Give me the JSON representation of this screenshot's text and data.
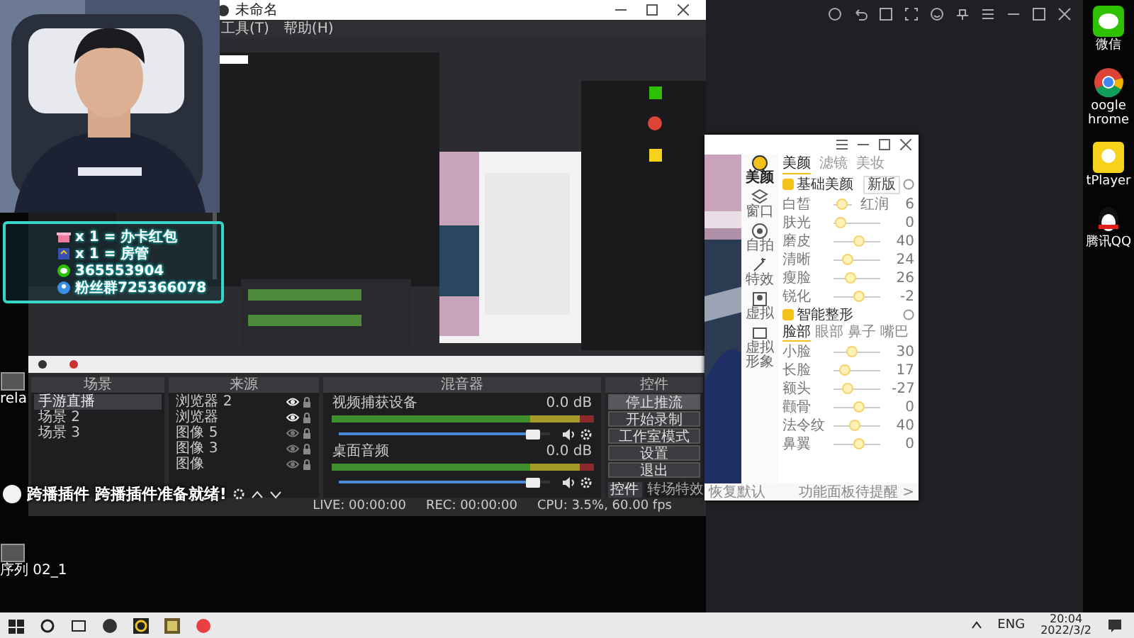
{
  "overlay": {
    "lines": [
      {
        "kind": "gift",
        "text": "x 1 = 办卡红包"
      },
      {
        "kind": "badge",
        "text": "x 1 = 房管"
      },
      {
        "kind": "wechat",
        "text": "365553904"
      },
      {
        "kind": "group",
        "text": "粉丝群725366078"
      }
    ]
  },
  "notification": {
    "text": "跨播插件 跨播插件准备就绪!"
  },
  "desktop_left": [
    {
      "label": "rela"
    },
    {
      "label": "序列 02_1"
    }
  ],
  "desktop_right": [
    {
      "kind": "chat",
      "label": "微信"
    },
    {
      "kind": "browser",
      "label": "oogle hrome"
    },
    {
      "kind": "player",
      "label": "tPlayer"
    },
    {
      "kind": "penguin",
      "label": "腾讯QQ"
    }
  ],
  "obs": {
    "title": "未命名",
    "menu": [
      "工具(T)",
      "帮助(H)"
    ],
    "scenes": {
      "title": "场景",
      "items": [
        {
          "label": "手游直播",
          "selected": true
        },
        {
          "label": "场景 2",
          "selected": false
        },
        {
          "label": "场景 3",
          "selected": false
        }
      ]
    },
    "sources": {
      "title": "来源",
      "items": [
        {
          "label": "浏览器 2",
          "visible": true
        },
        {
          "label": "浏览器",
          "visible": true
        },
        {
          "label": "图像 5",
          "visible": false
        },
        {
          "label": "图像 3",
          "visible": false
        },
        {
          "label": "图像",
          "visible": false
        }
      ]
    },
    "mixer": {
      "title": "混音器",
      "channels": [
        {
          "name": "视频捕获设备",
          "reading": "0.0 dB",
          "level": 0.95
        },
        {
          "name": "桌面音频",
          "reading": "0.0 dB",
          "level": 0.95
        }
      ]
    },
    "controls": {
      "title": "控件",
      "buttons": [
        "停止推流",
        "开始录制",
        "工作室模式",
        "设置",
        "退出"
      ],
      "tabs": [
        {
          "label": "控件",
          "selected": true
        },
        {
          "label": "转场特效",
          "selected": false
        }
      ]
    },
    "status": [
      "LIVE: 00:00:00",
      "REC: 00:00:00",
      "CPU: 3.5%, 60.00 fps"
    ]
  },
  "beauty": {
    "tabs": [
      {
        "label": "美颜",
        "selected": true
      },
      {
        "label": "滤镜",
        "selected": false
      },
      {
        "label": "美妆",
        "selected": false
      }
    ],
    "side": [
      {
        "kind": "face",
        "label": "美颜",
        "selected": true
      },
      {
        "kind": "layers",
        "label": "窗口",
        "selected": false
      },
      {
        "kind": "camera",
        "label": "自拍",
        "selected": false
      },
      {
        "kind": "magic",
        "label": "特效",
        "selected": false
      },
      {
        "kind": "portrait",
        "label": "虚拟",
        "selected": false
      },
      {
        "kind": "screen",
        "label": "虚拟形象",
        "selected": false
      }
    ],
    "basic": {
      "title": "基础美颜",
      "checked": true,
      "dropdown": "新版",
      "sliders": [
        {
          "name": "白皙",
          "extra": "红润",
          "value": "6",
          "level": 0.4
        },
        {
          "name": "肤光",
          "value": "0",
          "level": 0.05
        },
        {
          "name": "磨皮",
          "value": "40",
          "level": 0.55
        },
        {
          "name": "清晰",
          "value": "24",
          "level": 0.25
        },
        {
          "name": "瘦脸",
          "value": "26",
          "level": 0.3
        },
        {
          "name": "锐化",
          "value": "-2",
          "level": 0.55
        }
      ]
    },
    "shape": {
      "title": "智能整形",
      "checked": true,
      "tabs": [
        {
          "label": "脸部",
          "selected": true
        },
        {
          "label": "眼部",
          "selected": false
        },
        {
          "label": "鼻子",
          "selected": false
        },
        {
          "label": "嘴巴",
          "selected": false
        }
      ],
      "sliders": [
        {
          "name": "小脸",
          "value": "30",
          "level": 0.35
        },
        {
          "name": "长脸",
          "value": "17",
          "level": 0.15
        },
        {
          "name": "额头",
          "value": "-27",
          "level": 0.25
        },
        {
          "name": "颧骨",
          "value": "0",
          "level": 0.55
        },
        {
          "name": "法令纹",
          "value": "40",
          "level": 0.45
        },
        {
          "name": "鼻翼",
          "value": "0",
          "level": 0.55
        }
      ]
    },
    "footer": {
      "left": "恢复默认",
      "right": "功能面板待提醒 >"
    }
  },
  "taskbar": {
    "tray": "ENG",
    "time": "20:04",
    "date": "2022/3/2"
  }
}
